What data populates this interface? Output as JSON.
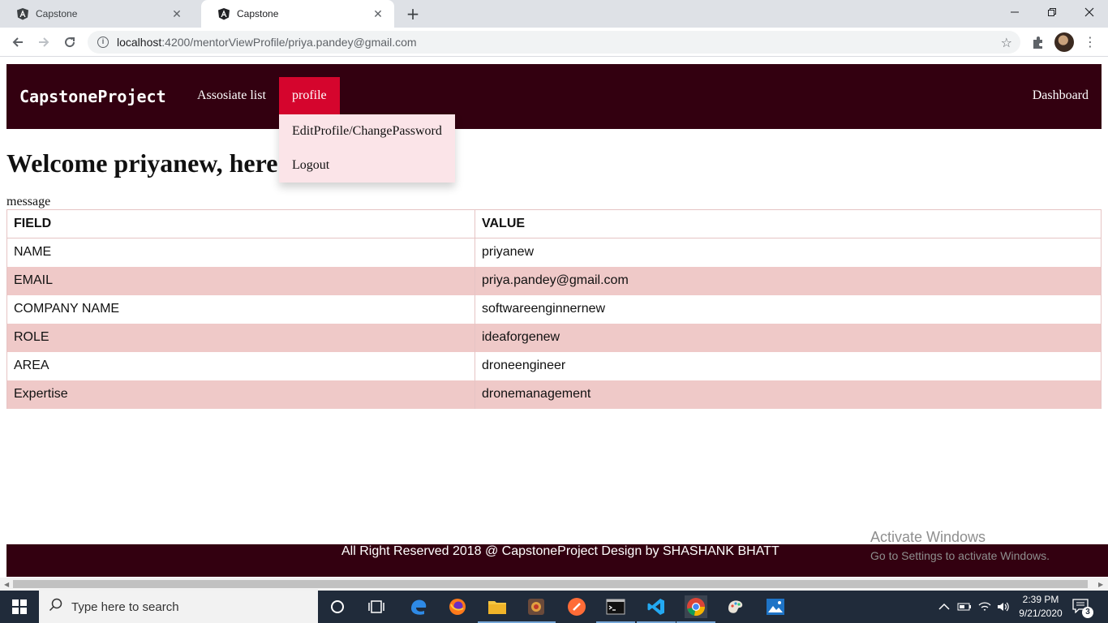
{
  "browser": {
    "tabs": [
      {
        "title": "Capstone"
      },
      {
        "title": "Capstone"
      }
    ],
    "url_host": "localhost",
    "url_path": ":4200/mentorViewProfile/priya.pandey@gmail.com"
  },
  "navbar": {
    "brand": "CapstoneProject",
    "links": {
      "associate_list": "Assosiate list",
      "profile": "profile",
      "dashboard": "Dashboard"
    },
    "dropdown": {
      "edit": "EditProfile/ChangePassword",
      "logout": "Logout"
    }
  },
  "page": {
    "welcome": "Welcome priyanew, here",
    "message": "message"
  },
  "table": {
    "headers": [
      "FIELD",
      "VALUE"
    ],
    "rows": [
      {
        "field": "NAME",
        "value": "priyanew"
      },
      {
        "field": "EMAIL",
        "value": "priya.pandey@gmail.com"
      },
      {
        "field": "COMPANY NAME",
        "value": "softwareenginnernew"
      },
      {
        "field": "ROLE",
        "value": "ideaforgenew"
      },
      {
        "field": "AREA",
        "value": "droneengineer"
      },
      {
        "field": "Expertise",
        "value": "dronemanagement"
      }
    ]
  },
  "footer": {
    "text": "All Right Reserved 2018 @ CapstoneProject Design by SHASHANK BHATT"
  },
  "watermark": {
    "line1": "Activate Windows",
    "line2": "Go to Settings to activate Windows."
  },
  "taskbar": {
    "search_placeholder": "Type here to search",
    "time": "2:39 PM",
    "date": "9/21/2020",
    "notification_count": "3"
  },
  "colors": {
    "nav_bg": "#330010",
    "active_link": "#d5052d",
    "dropdown_bg": "#fbe4e8",
    "stripe": "#efc9c8"
  }
}
